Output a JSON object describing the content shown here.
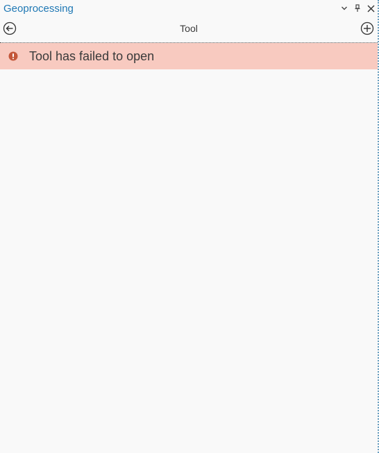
{
  "window": {
    "title": "Geoprocessing",
    "controls": {
      "options_icon": "chevron-down-icon",
      "pin_icon": "pin-icon",
      "close_icon": "close-icon"
    }
  },
  "navbar": {
    "title": "Tool",
    "back_icon": "back-arrow-circle-icon",
    "add_icon": "plus-circle-icon"
  },
  "error": {
    "message": "Tool has failed to open",
    "icon": "error-exclamation-icon",
    "background_color": "#f8cac0",
    "icon_color": "#c4573a"
  },
  "colors": {
    "accent": "#1f78b4",
    "pane_background": "#f9f9f9",
    "text": "#3a3a3a"
  }
}
